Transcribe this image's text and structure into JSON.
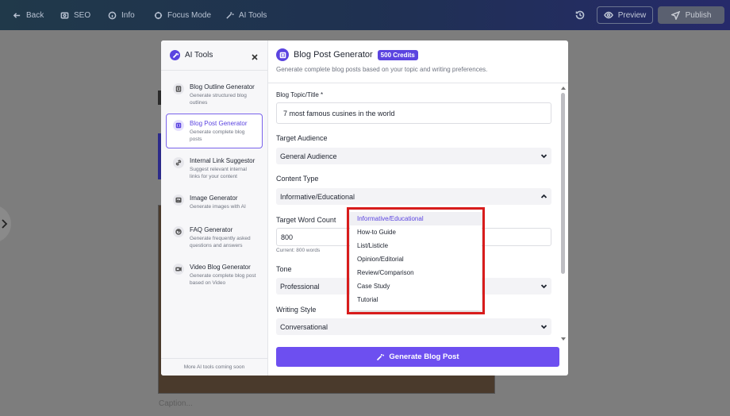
{
  "topbar": {
    "back": "Back",
    "seo": "SEO",
    "info": "Info",
    "focus_mode": "Focus Mode",
    "ai_tools": "AI Tools",
    "preview": "Preview",
    "publish": "Publish"
  },
  "editor": {
    "caption_placeholder": "Caption..."
  },
  "sidebar": {
    "title": "AI Tools",
    "footer": "More AI tools coming soon",
    "tools": [
      {
        "name": "Blog Outline Generator",
        "desc": "Generate structured blog outlines",
        "icon": "outline-icon"
      },
      {
        "name": "Blog Post Generator",
        "desc": "Generate complete blog posts",
        "icon": "document-icon"
      },
      {
        "name": "Internal Link Suggestor",
        "desc": "Suggest relevant internal links for your content",
        "icon": "link-icon"
      },
      {
        "name": "Image Generator",
        "desc": "Generate images with AI",
        "icon": "image-icon"
      },
      {
        "name": "FAQ Generator",
        "desc": "Generate frequently asked questions and answers",
        "icon": "question-icon"
      },
      {
        "name": "Video Blog Generator",
        "desc": "Generate complete blog post based on Video",
        "icon": "video-icon"
      }
    ]
  },
  "main": {
    "title": "Blog Post Generator",
    "credits": "500 Credits",
    "subtitle": "Generate complete blog posts based on your topic and writing preferences.",
    "topic_label": "Blog Topic/Title *",
    "topic_value": "7 most famous cusines in the world",
    "audience_label": "Target Audience",
    "audience_value": "General Audience",
    "content_type_label": "Content Type",
    "content_type_value": "Informative/Educational",
    "word_count_label": "Target Word Count",
    "word_count_value": "800",
    "word_count_hint": "Current: 800 words",
    "tone_label": "Tone",
    "tone_value": "Professional",
    "style_label": "Writing Style",
    "style_value": "Conversational",
    "generate_button": "Generate Blog Post"
  },
  "content_type_options": [
    "Informative/Educational",
    "How-to Guide",
    "List/Listicle",
    "Opinion/Editorial",
    "Review/Comparison",
    "Case Study",
    "Tutorial"
  ],
  "colors": {
    "accent": "#5b44e0",
    "button": "#6d4ff0",
    "highlight": "#d81c1c"
  }
}
